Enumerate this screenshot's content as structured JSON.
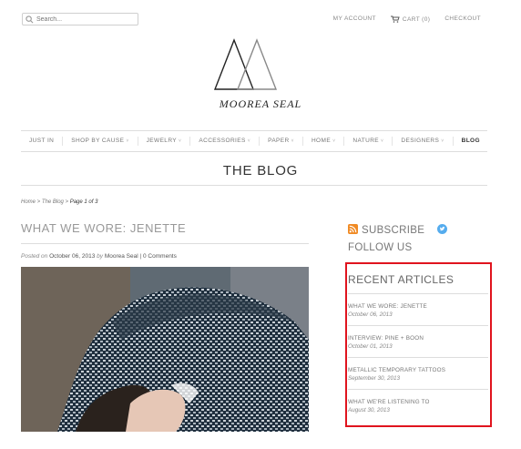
{
  "header": {
    "search_placeholder": "Search...",
    "my_account": "MY ACCOUNT",
    "cart": "CART (0)",
    "checkout": "CHECKOUT"
  },
  "brand": {
    "name": "MOOREA SEAL"
  },
  "nav": [
    {
      "label": "JUST IN",
      "dropdown": false
    },
    {
      "label": "SHOP BY CAUSE",
      "dropdown": true
    },
    {
      "label": "JEWELRY",
      "dropdown": true
    },
    {
      "label": "ACCESSORIES",
      "dropdown": true
    },
    {
      "label": "PAPER",
      "dropdown": true
    },
    {
      "label": "HOME",
      "dropdown": true
    },
    {
      "label": "NATURE",
      "dropdown": true
    },
    {
      "label": "DESIGNERS",
      "dropdown": true
    },
    {
      "label": "BLOG",
      "dropdown": false,
      "active": true
    }
  ],
  "page_title": "THE BLOG",
  "breadcrumb": {
    "home": "Home",
    "sep1": " > ",
    "blog": "The Blog",
    "sep2": " > ",
    "page": "Page 1 of 3"
  },
  "post": {
    "title": "WHAT WE WORE: JENETTE",
    "posted_on_prefix": "Posted on",
    "date": "October 06, 2013",
    "by": "by",
    "author": "Moorea Seal",
    "sep": "|",
    "comments": "0 Comments"
  },
  "sidebar": {
    "subscribe": "SUBSCRIBE",
    "follow": "FOLLOW US",
    "recent_heading": "RECENT ARTICLES",
    "recent": [
      {
        "title": "WHAT WE WORE: JENETTE",
        "date": "October 06, 2013"
      },
      {
        "title": "INTERVIEW: PINE + BOON",
        "date": "October 01, 2013"
      },
      {
        "title": "METALLIC TEMPORARY TATTOOS",
        "date": "September 30, 2013"
      },
      {
        "title": "WHAT WE'RE LISTENING TO",
        "date": "August 30, 2013"
      }
    ]
  },
  "colors": {
    "highlight_border": "#e0141e",
    "rss": "#f08a24",
    "twitter": "#55acee"
  },
  "icons": {
    "search": "search-icon",
    "cart": "cart-icon",
    "rss": "rss-icon",
    "twitter": "twitter-icon",
    "dropdown": "chevron-down-icon"
  }
}
